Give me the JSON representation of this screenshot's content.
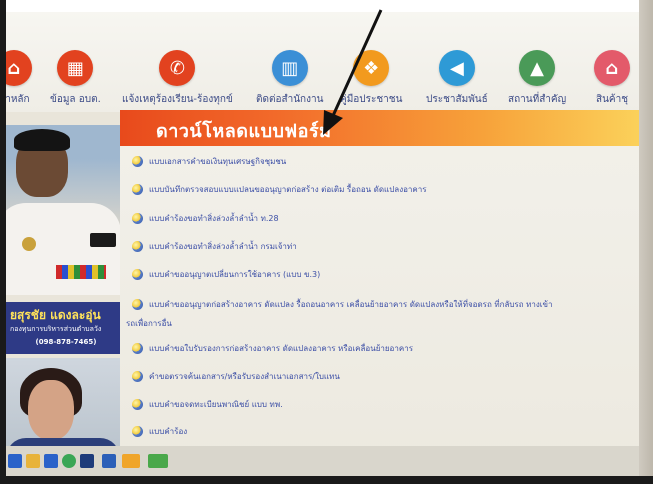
{
  "nav": {
    "items": [
      {
        "label": "น้าหลัก",
        "color": "#e2421f",
        "icon": "home-icon"
      },
      {
        "label": "ข้อมูล อบต.",
        "color": "#e2421f",
        "icon": "building-icon"
      },
      {
        "label": "แจ้งเหตุร้องเรียน-ร้องทุกข์",
        "color": "#e2421f",
        "icon": "phone-icon"
      },
      {
        "label": "ติดต่อสำนักงาน",
        "color": "#3b8fd6",
        "icon": "office-icon"
      },
      {
        "label": "คู่มือประชาชน",
        "color": "#f29a1e",
        "icon": "manual-icon"
      },
      {
        "label": "ประชาสัมพันธ์",
        "color": "#2e9ad6",
        "icon": "megaphone-icon"
      },
      {
        "label": "สถานที่สำคัญ",
        "color": "#4a9a58",
        "icon": "landmark-icon"
      },
      {
        "label": "สินค้าชุ",
        "color": "#e35a6a",
        "icon": "shop-icon"
      }
    ]
  },
  "banner": {
    "title": "ดาวน์โหลดแบบฟอร์ม"
  },
  "sidebar": {
    "name": "ยสุรชัย แดงละอุ่น",
    "role": "กองทุนการบริหารส่วนตำบลวัง",
    "phone": "(098-878-7465)"
  },
  "forms": [
    "แบบเอกสารคำขอเงินทุนเศรษฐกิจชุมชน",
    "แบบบันทึกตรวจสอบแบบแปลนขออนุญาตก่อสร้าง ต่อเติม รื้อถอน ดัดแปลงอาคาร",
    "แบบคำร้องขอทำสิ่งล่วงล้ำลำน้ำ ท.28",
    "แบบคำร้องขอทำสิ่งล่วงล้ำลำน้ำ กรมเจ้าท่า",
    "แบบคำขออนุญาตเปลี่ยนการใช้อาคาร (แบบ ข.3)",
    "แบบคำขออนุญาตก่อสร้างอาคาร ดัดแปลง รื้อถอนอาคาร เคลื่อนย้ายอาคาร ดัดแปลงหรือให้ที่จอดรถ ที่กลับรถ ทางเข้า",
    "แบบคำขอใบรับรองการก่อสร้างอาคาร ดัดแปลงอาคาร หรือเคลื่อนย้ายอาคาร",
    "คำขอตรวจค้นเอกสาร/หรือรับรองสำเนาเอกสาร/ใบแทน",
    "แบบคำขอจดทะเบียนพาณิชย์ แบบ ทพ.",
    "แบบคำร้อง"
  ],
  "forms_continuation": "รถเพื่อการอื่น"
}
